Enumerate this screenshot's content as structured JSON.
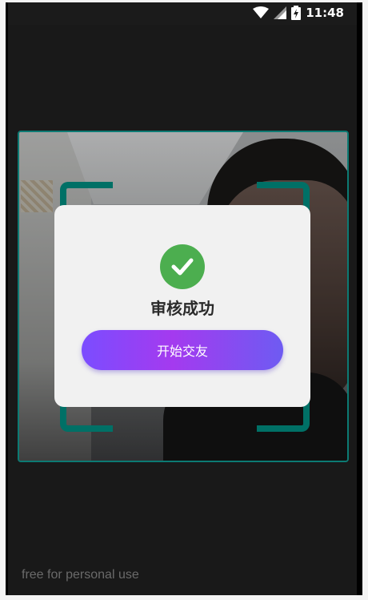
{
  "statusbar": {
    "time": "11:48"
  },
  "dialog": {
    "title": "审核成功",
    "button_label": "开始交友"
  },
  "footer": {
    "watermark": "free for personal use"
  },
  "colors": {
    "accent_teal": "#009688",
    "success_green": "#4cae4f",
    "button_gradient_start": "#7b4dff",
    "button_gradient_end": "#6e5bf2"
  },
  "icons": [
    "wifi-icon",
    "signal-icon",
    "battery-charging-icon",
    "check-circle-icon"
  ]
}
